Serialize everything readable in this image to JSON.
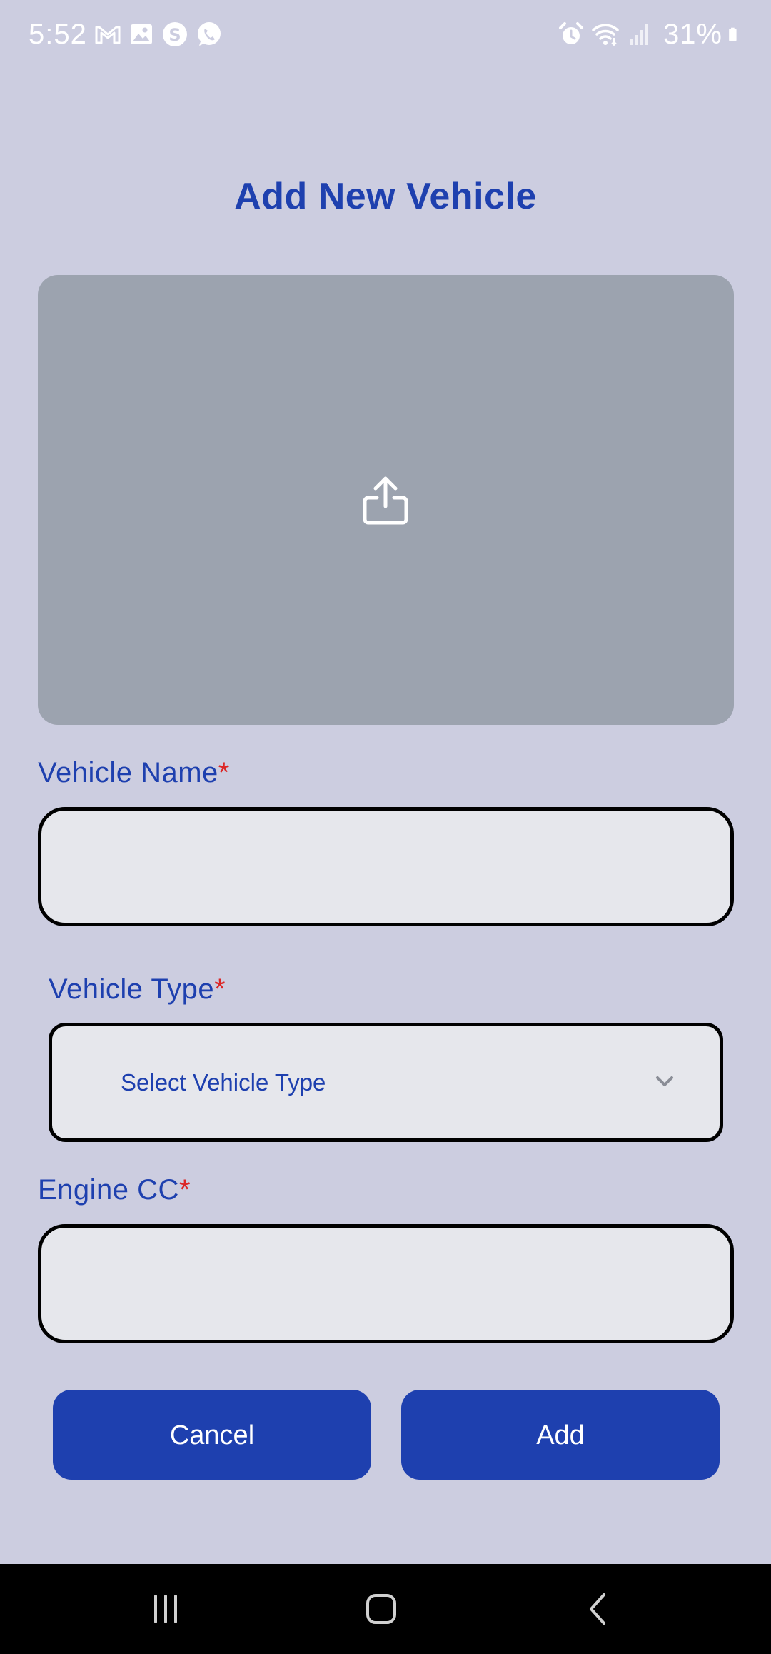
{
  "status_bar": {
    "time": "5:52",
    "battery": "31%",
    "left_icons": [
      "gmail-icon",
      "gallery-icon",
      "skype-icon",
      "whatsapp-icon"
    ],
    "right_icons": [
      "alarm-icon",
      "wifi-icon",
      "signal-icon",
      "battery-icon"
    ]
  },
  "page": {
    "title": "Add New Vehicle"
  },
  "upload": {
    "icon": "upload-icon"
  },
  "form": {
    "vehicle_name": {
      "label": "Vehicle Name",
      "required_mark": "*",
      "value": ""
    },
    "vehicle_type": {
      "label": "Vehicle Type",
      "required_mark": "*",
      "selected": "Select Vehicle Type",
      "icon": "chevron-down-icon"
    },
    "engine_cc": {
      "label": "Engine CC",
      "required_mark": "*",
      "value": ""
    }
  },
  "actions": {
    "cancel_label": "Cancel",
    "add_label": "Add"
  },
  "nav_bar": {
    "icons": [
      "recents-icon",
      "home-icon",
      "back-icon"
    ]
  },
  "colors": {
    "background": "#cccde0",
    "accent": "#1e40af",
    "required": "#dc2626",
    "upload_area": "#9ca3af",
    "input_fill": "#e6e7ec"
  }
}
